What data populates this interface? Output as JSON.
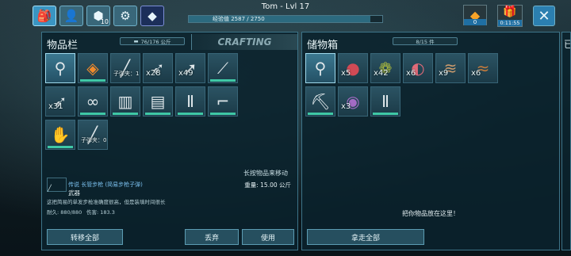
{
  "header": {
    "player_name": "Tom - Lvl 17",
    "xp_text": "经验值 2587 / 2750",
    "xp_progress": 0.94,
    "engram_badge": "10",
    "currency_value": "0",
    "gift_timer": "0:11:55"
  },
  "inventory": {
    "title": "物品栏",
    "capacity": "76/176 公斤",
    "crafting_tab": "CRAFTING",
    "hint": "长按物品来移动",
    "slots": [
      {
        "icon": "search-icon",
        "qty": ""
      },
      {
        "icon": "implant-icon",
        "qty": ""
      },
      {
        "icon": "rifle-icon",
        "qty": "子弹夹：1"
      },
      {
        "icon": "arrow-icon",
        "qty": "x28"
      },
      {
        "icon": "spear-icon",
        "qty": "x49"
      },
      {
        "icon": "pike-icon",
        "qty": ""
      },
      {
        "icon": "arrow-icon",
        "qty": "x31"
      },
      {
        "icon": "glasses-icon",
        "qty": ""
      },
      {
        "icon": "armor-shirt-icon",
        "qty": ""
      },
      {
        "icon": "armor-pants-icon",
        "qty": ""
      },
      {
        "icon": "armor-legs-icon",
        "qty": ""
      },
      {
        "icon": "boots-icon",
        "qty": ""
      },
      {
        "icon": "gauntlets-icon",
        "qty": ""
      },
      {
        "icon": "rifle-icon",
        "qty": "子弹夹：0"
      }
    ],
    "selected_item": {
      "name": "传说 长管步枪 (简易步枪子弹)",
      "category": "武器",
      "weight": "重量: 15.00 公斤",
      "description": "这把简易的单发步枪准确度很高，但是装填时间很长",
      "durability": "耐久: 880/880",
      "damage": "伤害: 183.3"
    },
    "buttons": {
      "transfer_all": "转移全部",
      "drop": "丢弃",
      "use": "使用"
    }
  },
  "storage": {
    "title": "储物箱",
    "capacity": "8/15 件",
    "empty_hint": "把你物品放在这里！",
    "take_all": "拿走全部",
    "slots": [
      {
        "icon": "search-icon",
        "qty": ""
      },
      {
        "icon": "raw-meat-icon",
        "qty": "x5"
      },
      {
        "icon": "berries-icon",
        "qty": "x42"
      },
      {
        "icon": "prime-meat-icon",
        "qty": "x6"
      },
      {
        "icon": "hide-icon",
        "qty": "x9"
      },
      {
        "icon": "leather-icon",
        "qty": "x6"
      },
      {
        "icon": "pickaxe-icon",
        "qty": ""
      },
      {
        "icon": "narcoberry-bowl-icon",
        "qty": "x3"
      },
      {
        "icon": "chitin-pants-icon",
        "qty": ""
      }
    ]
  },
  "third_panel_glyph": "已"
}
